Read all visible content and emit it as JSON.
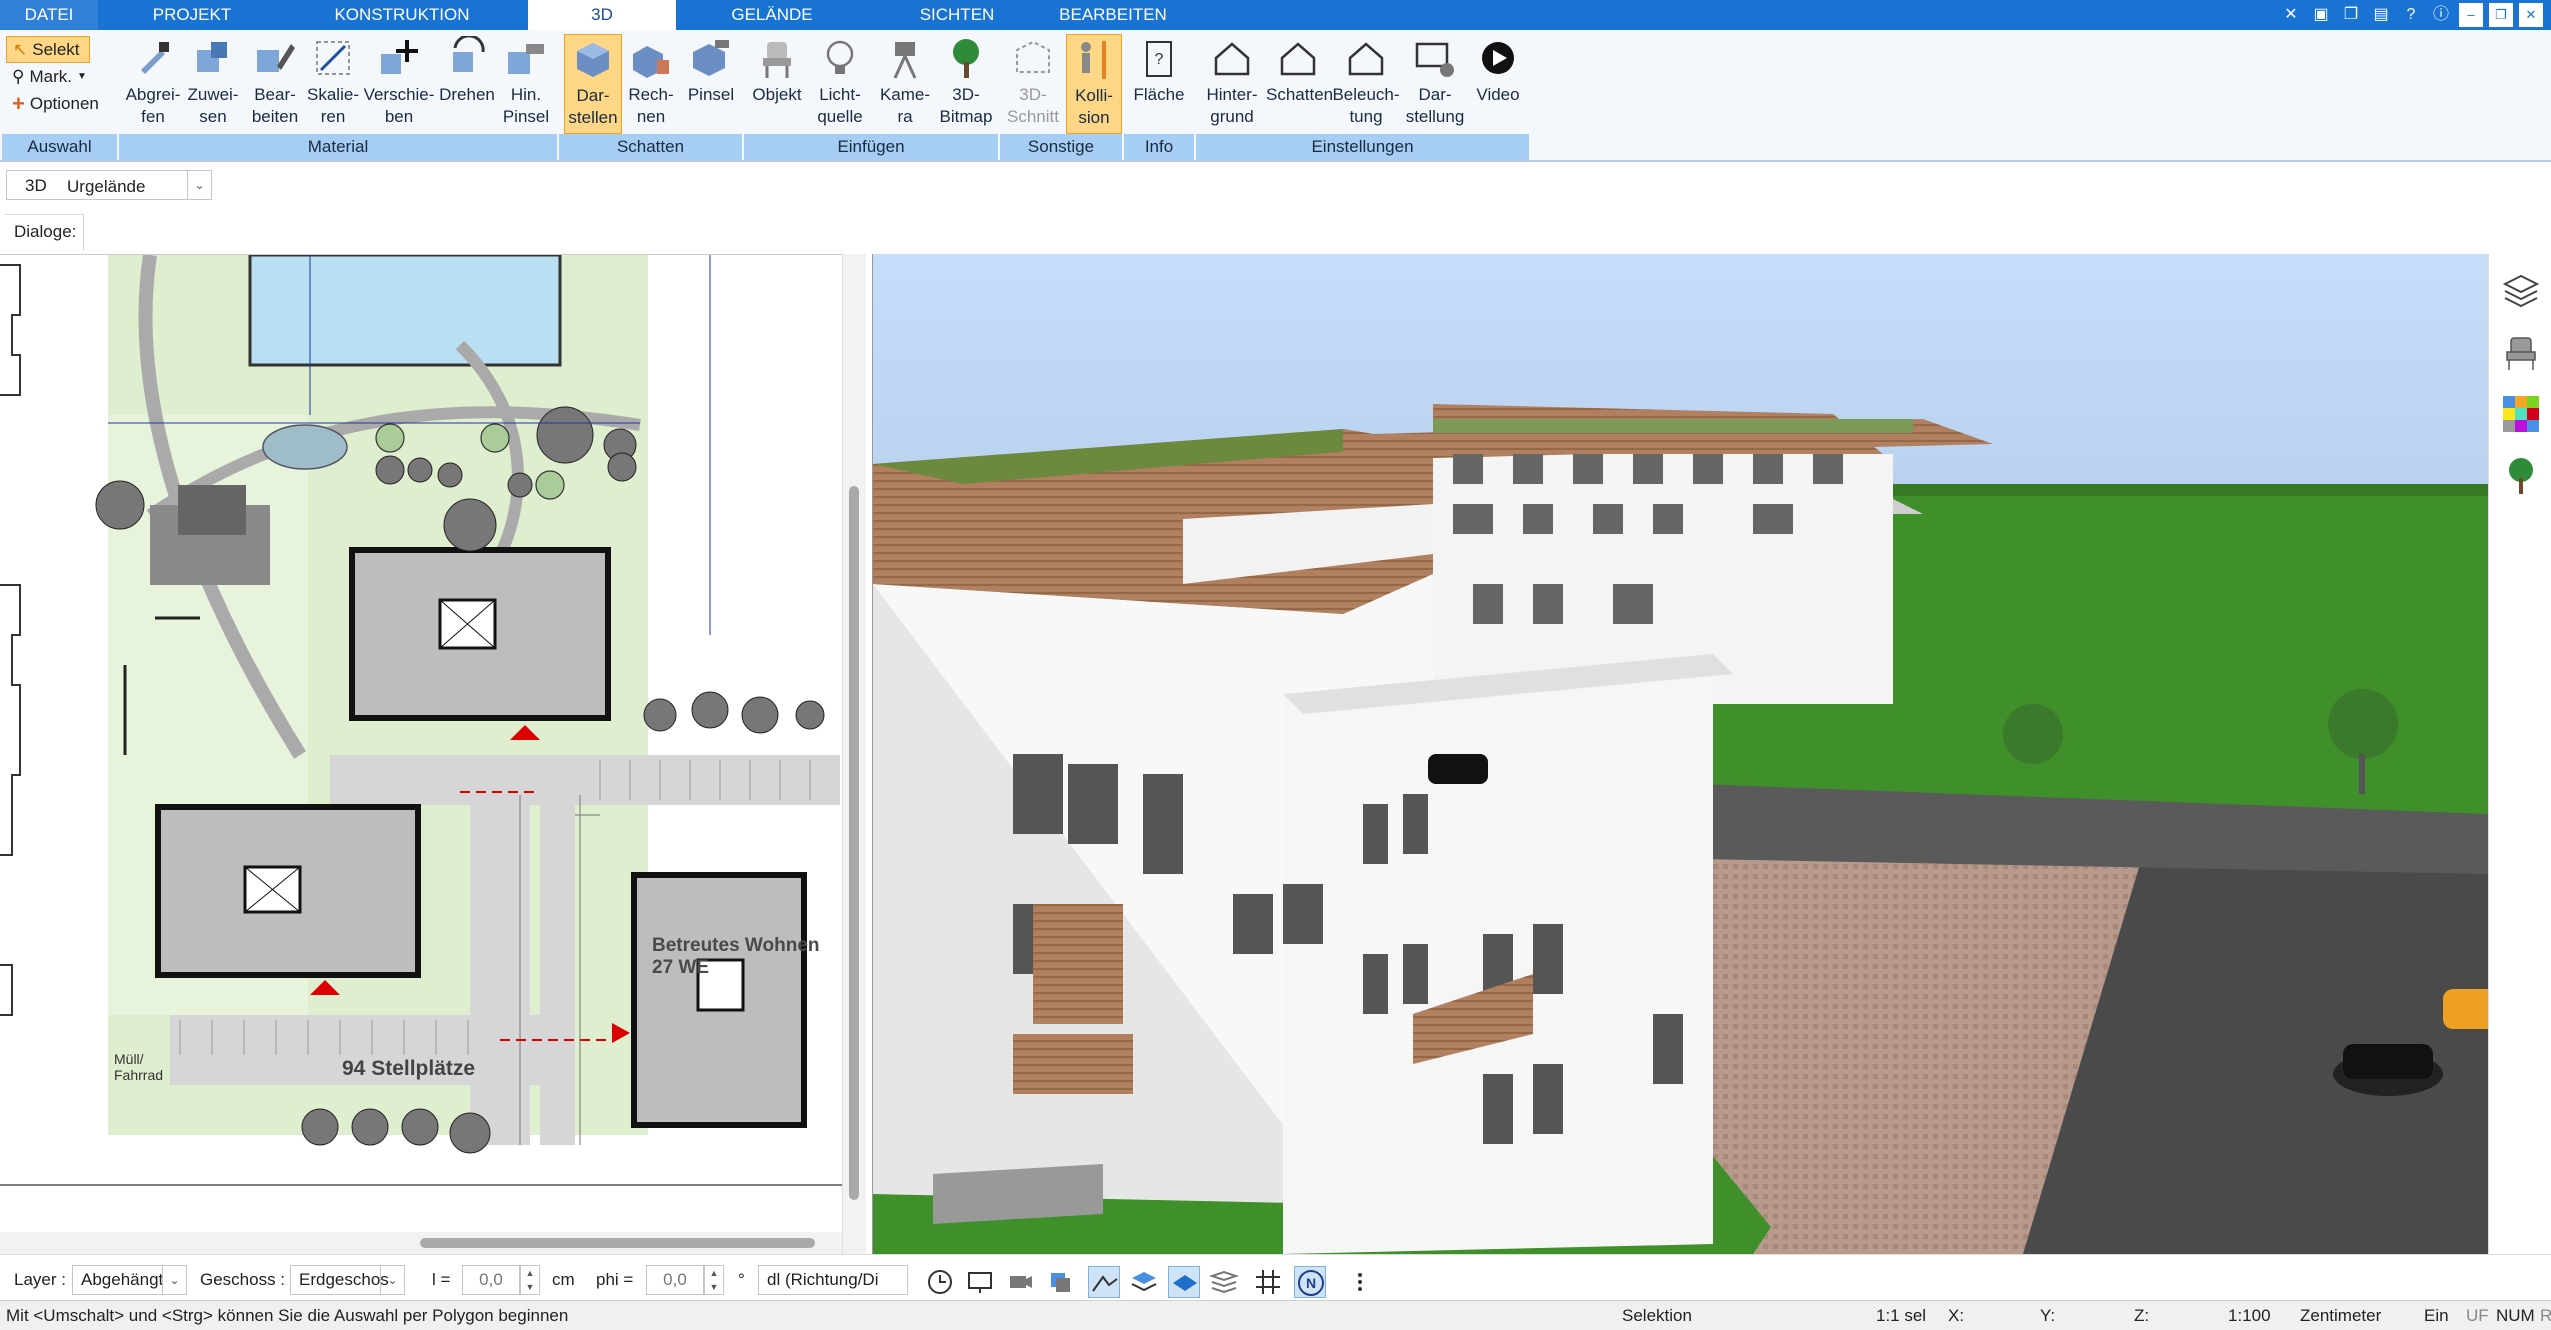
{
  "tabs": [
    "DATEI",
    "PROJEKT",
    "KONSTRUKTION",
    "3D",
    "GELÄNDE",
    "SICHTEN",
    "BEARBEITEN"
  ],
  "active_tab": "3D",
  "selection": {
    "select": "Selekt",
    "mark": "Mark.",
    "options": "Optionen",
    "group": "Auswahl"
  },
  "material": {
    "group": "Material",
    "buttons": [
      {
        "line1": "Abgrei-",
        "line2": "fen"
      },
      {
        "line1": "Zuwei-",
        "line2": "sen"
      },
      {
        "line1": "Bear-",
        "line2": "beiten"
      },
      {
        "line1": "Skalie-",
        "line2": "ren"
      },
      {
        "line1": "Verschie-",
        "line2": "ben"
      },
      {
        "line1": "Drehen",
        "line2": ""
      },
      {
        "line1": "Hin.",
        "line2": "Pinsel"
      }
    ]
  },
  "schatten": {
    "group": "Schatten",
    "buttons": [
      {
        "line1": "Dar-",
        "line2": "stellen"
      },
      {
        "line1": "Rech-",
        "line2": "nen"
      },
      {
        "line1": "Pinsel",
        "line2": ""
      }
    ]
  },
  "einfuegen": {
    "group": "Einfügen",
    "buttons": [
      {
        "line1": "Objekt",
        "line2": ""
      },
      {
        "line1": "Licht-",
        "line2": "quelle"
      },
      {
        "line1": "Kame-",
        "line2": "ra"
      },
      {
        "line1": "3D-",
        "line2": "Bitmap"
      }
    ]
  },
  "sonstige": {
    "group": "Sonstige",
    "buttons": [
      {
        "line1": "3D-",
        "line2": "Schnitt"
      },
      {
        "line1": "Kolli-",
        "line2": "sion"
      }
    ]
  },
  "info": {
    "group": "Info",
    "buttons": [
      {
        "line1": "Fläche",
        "line2": ""
      }
    ]
  },
  "einstellungen": {
    "group": "Einstellungen",
    "buttons": [
      {
        "line1": "Hinter-",
        "line2": "grund"
      },
      {
        "line1": "Schatten",
        "line2": ""
      },
      {
        "line1": "Beleuch-",
        "line2": "tung"
      },
      {
        "line1": "Dar-",
        "line2": "stellung"
      },
      {
        "line1": "Video",
        "line2": ""
      }
    ]
  },
  "view_bar": {
    "mode": "3D",
    "terrain": "Urgelände"
  },
  "dialog_label": "Dialoge:",
  "plan_labels": {
    "betreutes": "Betreutes Wohnen",
    "we": "27 WE",
    "muell": "Müll/",
    "fahrrad": "Fahrrad",
    "parking": "94 Stellplätze"
  },
  "bottom": {
    "layer_label": "Layer :",
    "layer_value": "Abgehängt",
    "geschoss_label": "Geschoss :",
    "geschoss_value": "Erdgeschos",
    "l_label": "l =",
    "l_value": "0,0",
    "unit": "cm",
    "phi_label": "phi =",
    "phi_value": "0,0",
    "deg": "°",
    "dl_value": "dl (Richtung/Di"
  },
  "status": {
    "hint": "Mit <Umschalt> und <Strg> können Sie die Auswahl per Polygon beginnen",
    "mode": "Selektion",
    "scale_sel": "1:1 sel",
    "x": "X:",
    "y": "Y:",
    "z": "Z:",
    "scale": "1:100",
    "unit": "Zentimeter",
    "ein": "Ein",
    "uf": "UF",
    "num": "NUM",
    "r": "R"
  },
  "colors": {
    "accent": "#1873d3",
    "ribbon_group": "#a6cdf3",
    "selected": "#fdd785",
    "grass": "#3f8f2a",
    "sky": "#b8d6f3"
  }
}
